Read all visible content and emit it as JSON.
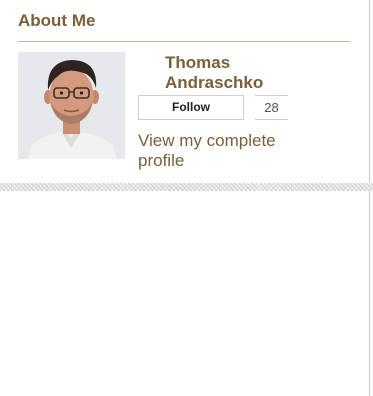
{
  "widget": {
    "title": "About Me",
    "author_name": "Thomas Andraschko",
    "follow_label": "Follow",
    "follower_count": "28",
    "view_profile_label": "View my complete profile"
  },
  "colors": {
    "accent": "#7a5f3a",
    "rule": "#c7b9a1"
  }
}
